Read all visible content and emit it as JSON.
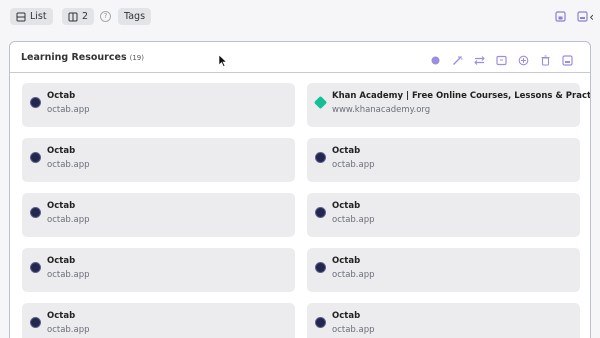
{
  "toolbar": {
    "list_label": "List",
    "columns_label": "2",
    "tags_label": "Tags",
    "help_glyph": "?",
    "collapse_glyph": "‹"
  },
  "panel": {
    "title": "Learning Resources",
    "count": "(19)",
    "accent_color": "#9b8ee0"
  },
  "cards": [
    {
      "title": "Octab",
      "url": "octab.app",
      "icon": "octab-icon"
    },
    {
      "title": "Khan Academy | Free Online Courses, Lessons & Practice",
      "url": "www.khanacademy.org",
      "icon": "khan-academy-icon"
    },
    {
      "title": "Octab",
      "url": "octab.app",
      "icon": "octab-icon"
    },
    {
      "title": "Octab",
      "url": "octab.app",
      "icon": "octab-icon"
    },
    {
      "title": "Octab",
      "url": "octab.app",
      "icon": "octab-icon"
    },
    {
      "title": "Octab",
      "url": "octab.app",
      "icon": "octab-icon"
    },
    {
      "title": "Octab",
      "url": "octab.app",
      "icon": "octab-icon"
    },
    {
      "title": "Octab",
      "url": "octab.app",
      "icon": "octab-icon"
    },
    {
      "title": "Octab",
      "url": "octab.app",
      "icon": "octab-icon"
    },
    {
      "title": "Octab",
      "url": "octab.app",
      "icon": "octab-icon"
    }
  ]
}
